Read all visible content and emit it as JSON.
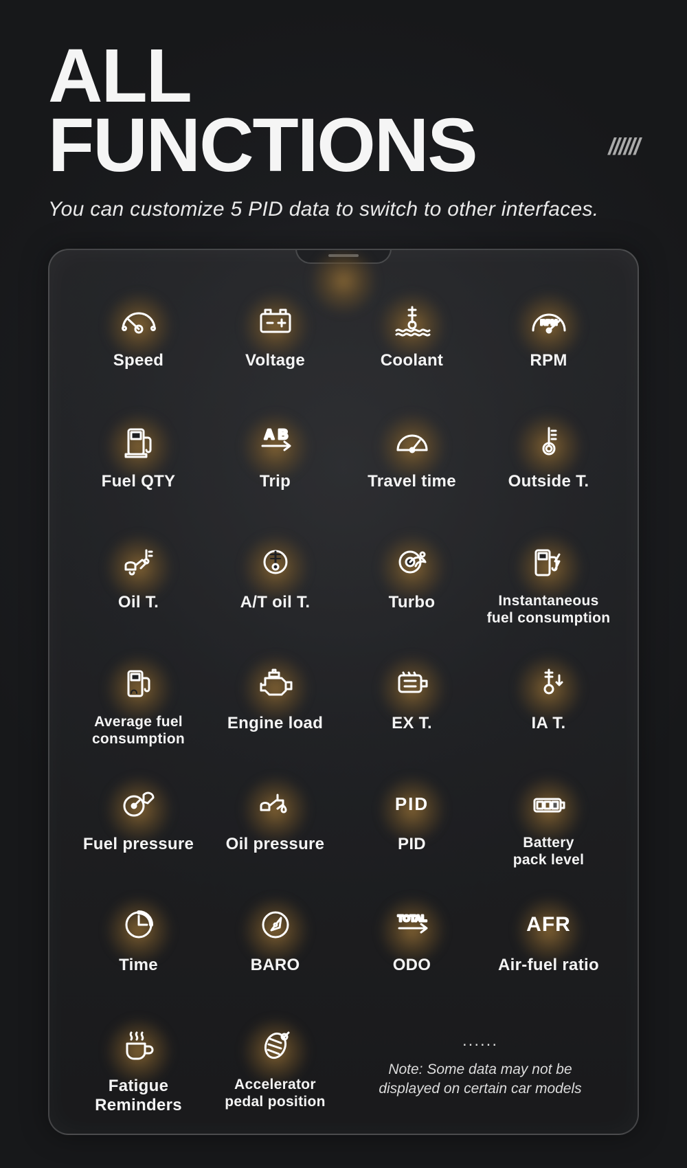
{
  "header": {
    "title": "ALL\nFUNCTIONS",
    "hashes": "//////",
    "subtitle": "You can customize 5 PID data to switch to other interfaces."
  },
  "note": {
    "dots": "......",
    "text": "Note:  Some data may not be displayed on certain car models"
  },
  "items": [
    {
      "key": "speed",
      "label": "Speed",
      "icon": "speed-icon"
    },
    {
      "key": "voltage",
      "label": "Voltage",
      "icon": "battery-plus-icon"
    },
    {
      "key": "coolant",
      "label": "Coolant",
      "icon": "coolant-temp-icon"
    },
    {
      "key": "rpm",
      "label": "RPM",
      "icon": "rpm-gauge-icon"
    },
    {
      "key": "fuel-qty",
      "label": "Fuel QTY",
      "icon": "fuel-pump-icon"
    },
    {
      "key": "trip",
      "label": "Trip",
      "icon": "trip-ab-icon"
    },
    {
      "key": "travel-time",
      "label": "Travel time",
      "icon": "sunrise-gauge-icon"
    },
    {
      "key": "outside-temp",
      "label": "Outside T.",
      "icon": "thermometer-icon"
    },
    {
      "key": "oil-temp",
      "label": "Oil T.",
      "icon": "oil-temp-icon"
    },
    {
      "key": "at-oil-temp",
      "label": "A/T oil T.",
      "icon": "at-oil-temp-icon"
    },
    {
      "key": "turbo",
      "label": "Turbo",
      "icon": "turbo-icon"
    },
    {
      "key": "inst-fuel",
      "label": "Instantaneous\nfuel consumption",
      "icon": "fuel-bolt-icon",
      "small": true
    },
    {
      "key": "avg-fuel",
      "label": "Average fuel\nconsumption",
      "icon": "fuel-avg-icon",
      "small": true
    },
    {
      "key": "engine-load",
      "label": "Engine load",
      "icon": "engine-icon"
    },
    {
      "key": "ex-t",
      "label": "EX T.",
      "icon": "ex-temp-icon"
    },
    {
      "key": "ia-t",
      "label": "IA T.",
      "icon": "intake-temp-icon"
    },
    {
      "key": "fuel-pressure",
      "label": "Fuel pressure",
      "icon": "fuel-pressure-icon"
    },
    {
      "key": "oil-pressure",
      "label": "Oil pressure",
      "icon": "oil-pressure-icon"
    },
    {
      "key": "pid",
      "label": "PID",
      "icon": "pid-text-icon"
    },
    {
      "key": "battery-pack",
      "label": "Battery\npack level",
      "icon": "battery-level-icon",
      "small": true
    },
    {
      "key": "time",
      "label": "Time",
      "icon": "clock-icon"
    },
    {
      "key": "baro",
      "label": "BARO",
      "icon": "compass-icon"
    },
    {
      "key": "odo",
      "label": "ODO",
      "icon": "odo-total-icon"
    },
    {
      "key": "afr",
      "label": "Air-fuel ratio",
      "icon": "afr-text-icon"
    },
    {
      "key": "fatigue",
      "label": "Fatigue\nReminders",
      "icon": "coffee-cup-icon"
    },
    {
      "key": "accelerator",
      "label": "Accelerator\npedal position",
      "icon": "pedal-icon",
      "small": true
    }
  ],
  "colors": {
    "halo": "#8a6834",
    "bg": "#1e1f22",
    "text": "#f2f2f2"
  }
}
